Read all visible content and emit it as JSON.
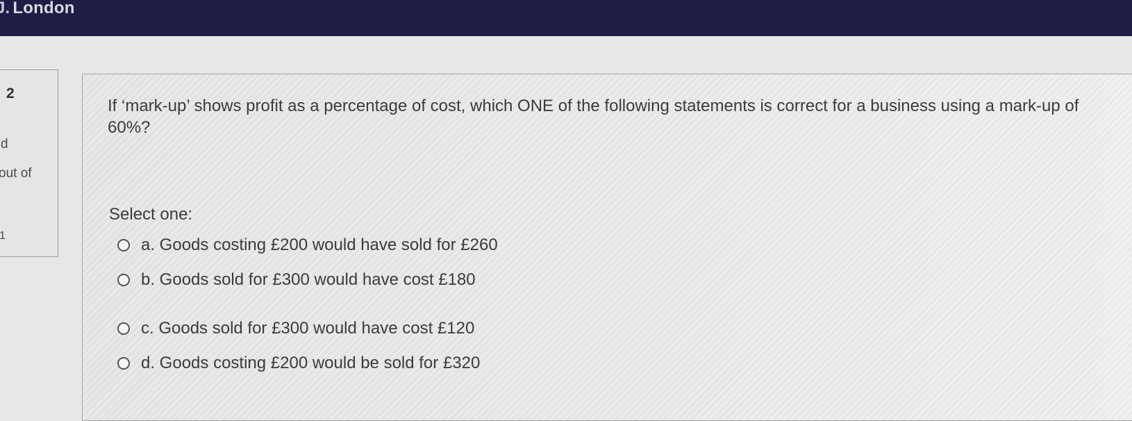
{
  "header": {
    "brand_mark": "J.",
    "brand_text": "London"
  },
  "info": {
    "question_number": "2",
    "status": "d",
    "grade": "out of",
    "flag": "1"
  },
  "question": {
    "text": "If ‘mark-up’ shows profit as a percentage of cost, which ONE of the following statements is correct for a business using a mark-up of 60%?",
    "prompt": "Select one:",
    "options": [
      {
        "label": "a. Goods costing £200 would have sold for £260"
      },
      {
        "label": "b. Goods sold for £300 would have cost £180"
      },
      {
        "label": "c. Goods sold for £300 would have cost £120"
      },
      {
        "label": "d. Goods costing £200 would be sold for £320"
      }
    ]
  }
}
